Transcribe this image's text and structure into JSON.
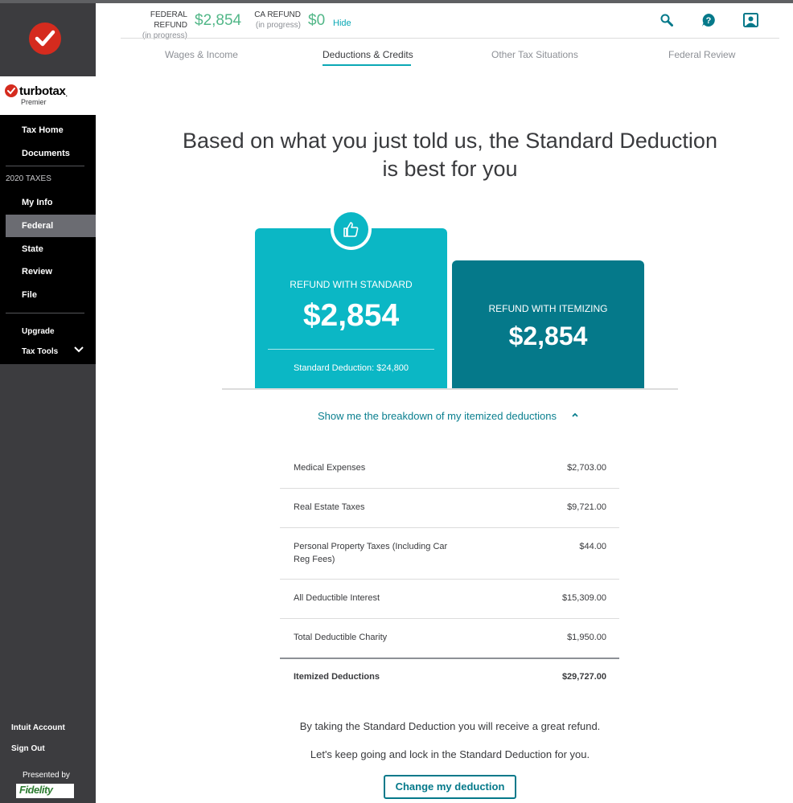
{
  "sidebar": {
    "brand_name": "turbotax",
    "brand_edition": "Premier",
    "nav": {
      "tax_home": "Tax Home",
      "documents": "Documents",
      "section": "2020 TAXES",
      "my_info": "My Info",
      "federal": "Federal",
      "state": "State",
      "review": "Review",
      "file": "File",
      "upgrade": "Upgrade",
      "tax_tools": "Tax Tools"
    },
    "footer": {
      "intuit_account": "Intuit Account",
      "sign_out": "Sign Out",
      "presented_by": "Presented by",
      "sponsor": "Fidelity"
    }
  },
  "header": {
    "federal_label": "FEDERAL REFUND",
    "federal_status": "(in progress)",
    "federal_amount": "$2,854",
    "ca_label": "CA REFUND",
    "ca_status": "(in progress)",
    "ca_amount": "$0",
    "hide_label": "Hide",
    "icons": [
      "search-icon",
      "help-icon",
      "profile-icon"
    ]
  },
  "tabs": [
    {
      "label": "Wages & Income",
      "active": false
    },
    {
      "label": "Deductions & Credits",
      "active": true
    },
    {
      "label": "Other Tax Situations",
      "active": false
    },
    {
      "label": "Federal Review",
      "active": false
    }
  ],
  "main": {
    "headline_line1": "Based on what you just told us, the Standard Deduction",
    "headline_line2": "is best for you",
    "standard": {
      "label": "REFUND WITH STANDARD",
      "amount": "$2,854",
      "deduction_note": "Standard Deduction: $24,800"
    },
    "itemizing": {
      "label": "REFUND WITH ITEMIZING",
      "amount": "$2,854"
    },
    "breakdown_link": "Show me the breakdown of my itemized deductions",
    "breakdown": [
      {
        "label": "Medical Expenses",
        "value": "$2,703.00"
      },
      {
        "label": "Real Estate Taxes",
        "value": "$9,721.00"
      },
      {
        "label": "Personal Property Taxes (Including Car Reg Fees)",
        "value": "$44.00"
      },
      {
        "label": "All Deductible Interest",
        "value": "$15,309.00"
      },
      {
        "label": "Total Deductible Charity",
        "value": "$1,950.00"
      }
    ],
    "total": {
      "label": "Itemized Deductions",
      "value": "$29,727.00"
    },
    "note1": "By taking the Standard Deduction you will receive a great refund.",
    "note2_prefix": "Let's keep going and lock in the ",
    "note2_bold": "Standard Deduction",
    "note2_suffix": " for you.",
    "change_button": "Change my deduction"
  },
  "colors": {
    "standard_card": "#0bb7c5",
    "itemizing_card": "#05798a",
    "refund_green": "#52b788",
    "brand_red": "#d52b1e",
    "accent_teal": "#0aa8b5"
  }
}
